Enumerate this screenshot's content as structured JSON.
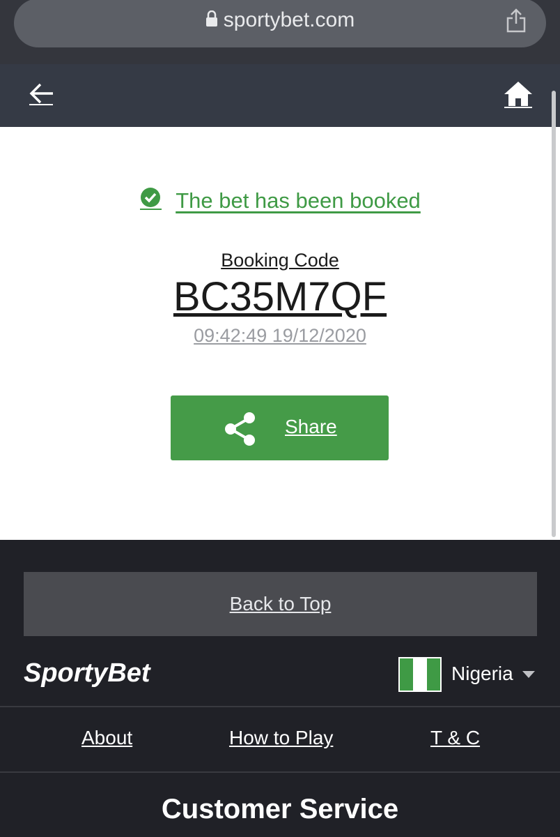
{
  "browser": {
    "url": "sportybet.com"
  },
  "booking": {
    "status_text": "The bet has been booked",
    "code_label": "Booking Code",
    "code": "BC35M7QF",
    "timestamp": "09:42:49 19/12/2020",
    "share_label": "Share"
  },
  "footer": {
    "back_to_top": "Back to Top",
    "logo": "SportyBet",
    "country": "Nigeria",
    "links": {
      "about": "About",
      "how_to_play": "How to Play",
      "tc": "T & C"
    },
    "customer_service": "Customer Service"
  },
  "colors": {
    "accent_green": "#459b48",
    "header_bg": "#353a45",
    "footer_bg": "#202127"
  },
  "icons": [
    "lock-icon",
    "os-share-icon",
    "back-arrow-icon",
    "home-icon",
    "check-circle-icon",
    "share-icon",
    "chevron-down-icon"
  ]
}
